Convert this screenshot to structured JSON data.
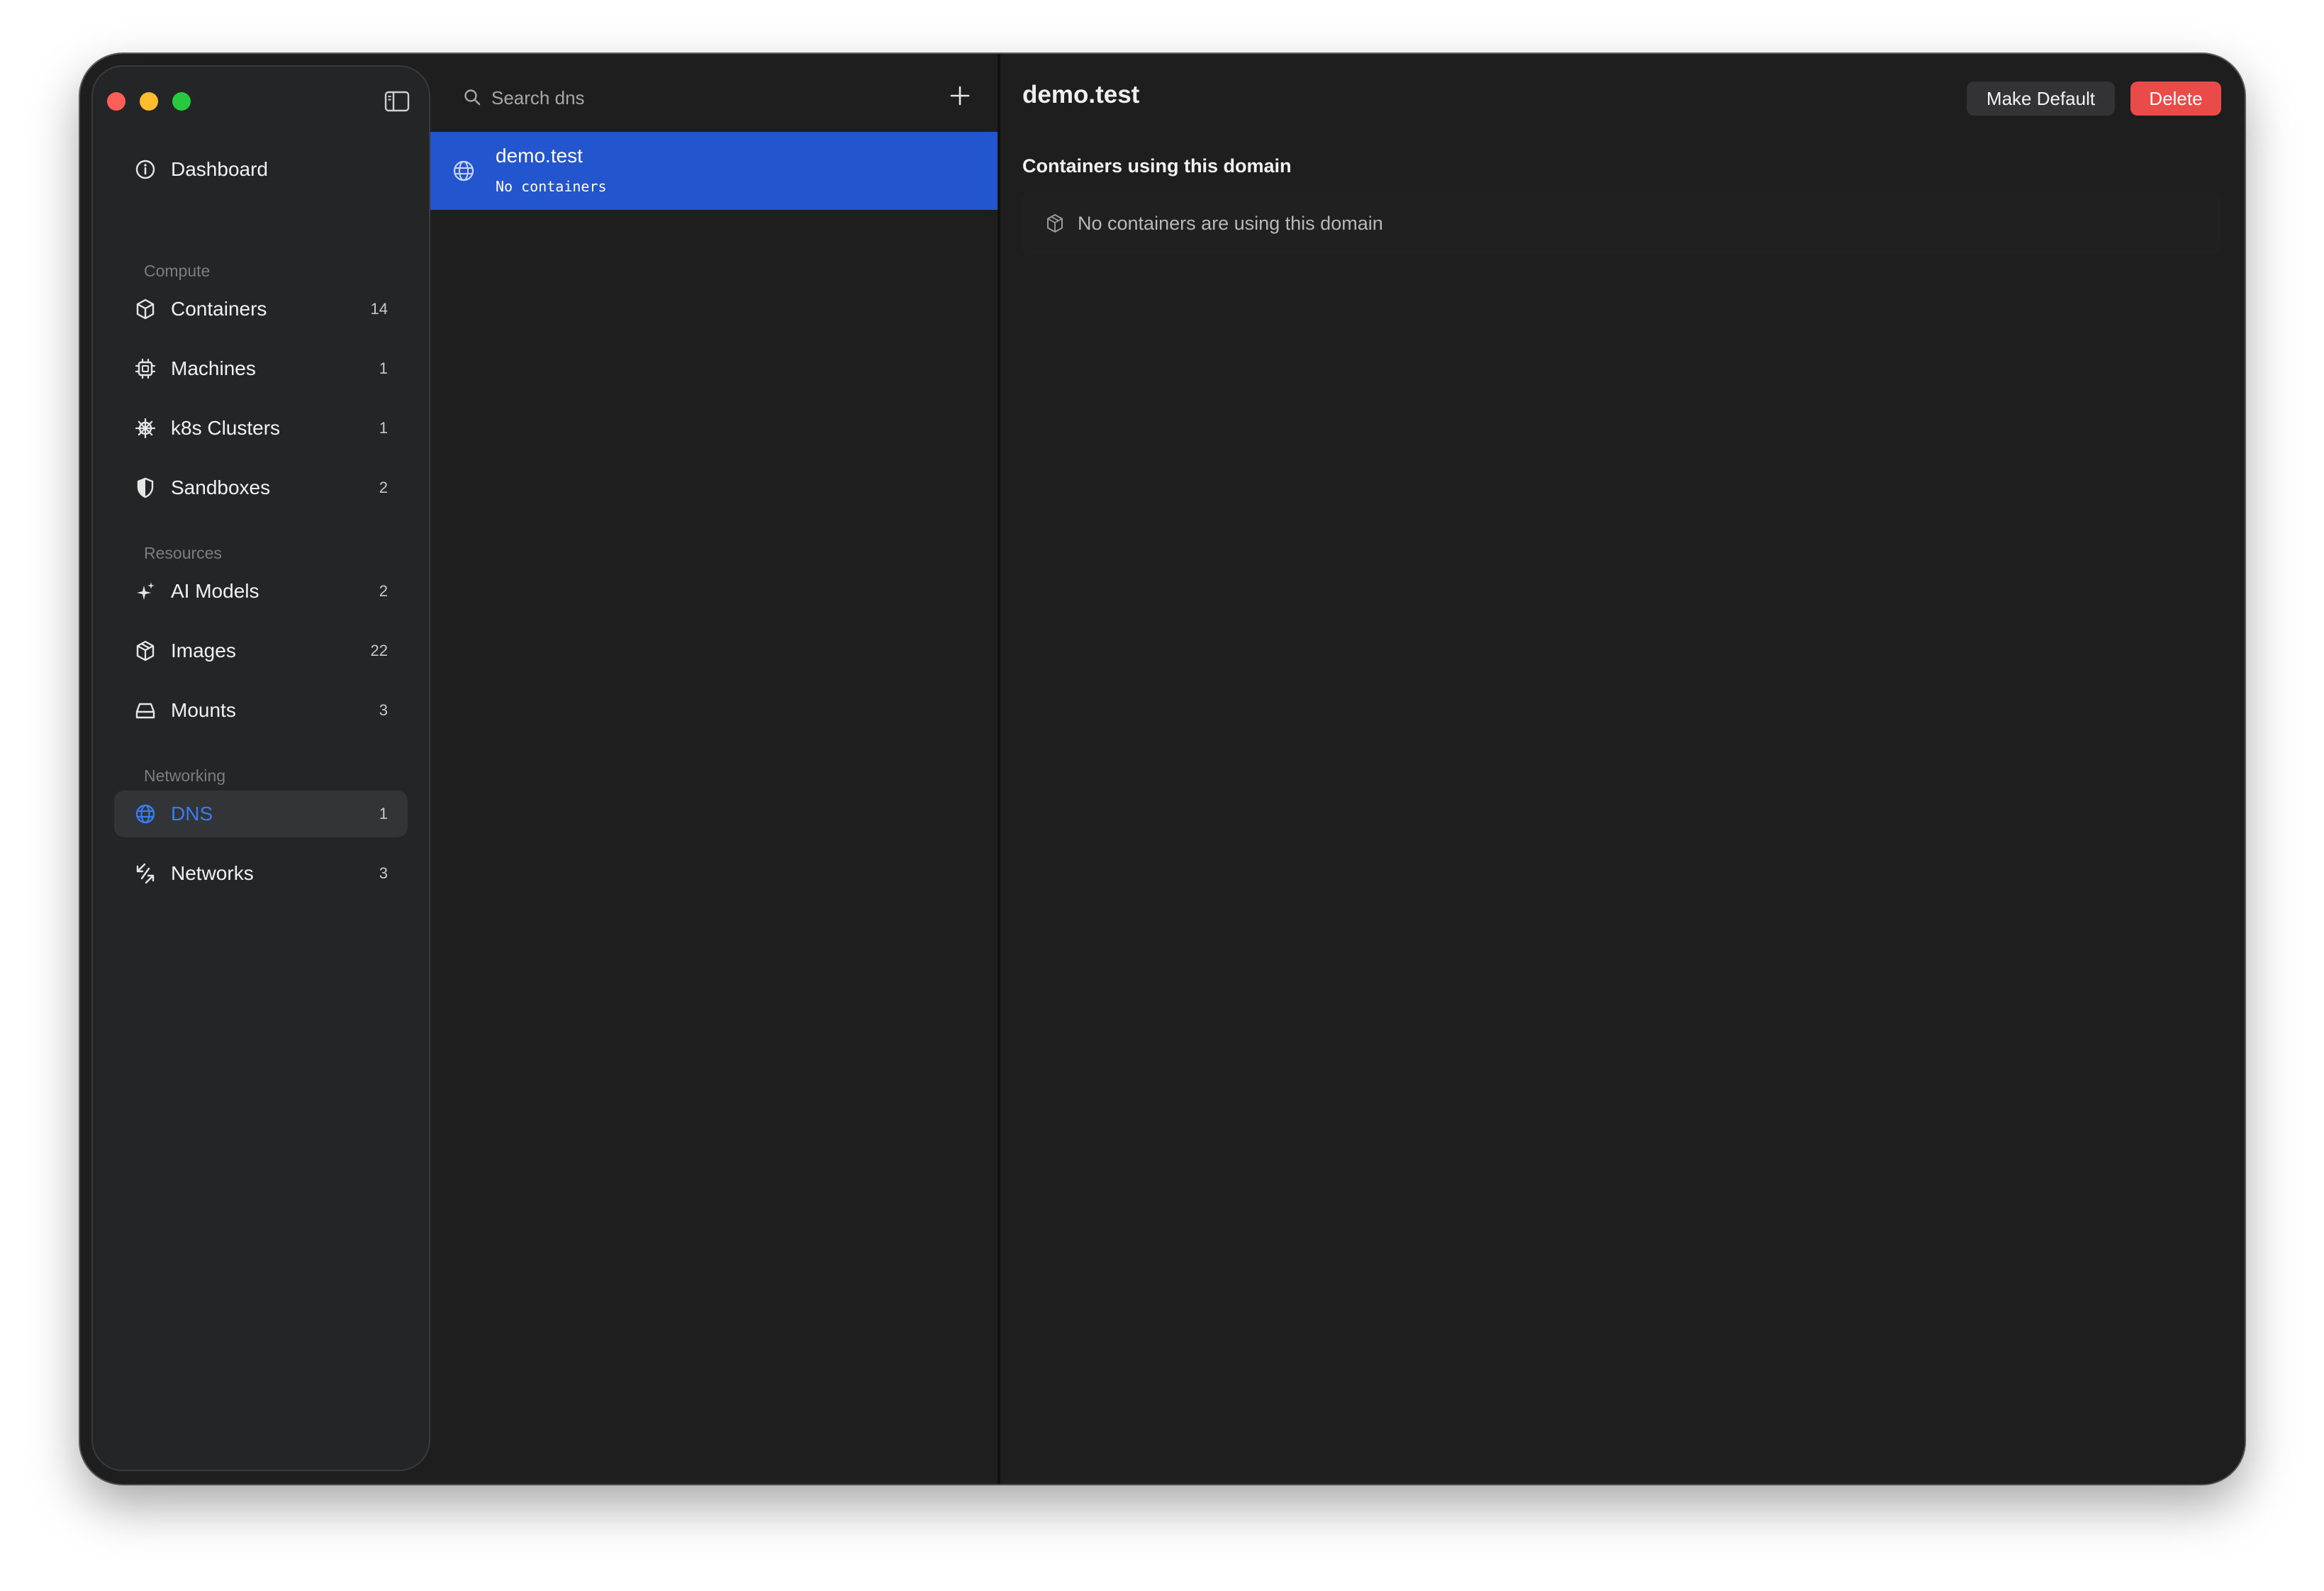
{
  "sidebar": {
    "toggle_icon": "sidebar-toggle-icon",
    "dashboard": {
      "label": "Dashboard",
      "icon": "info-icon"
    },
    "sections": {
      "compute": "Compute",
      "resources": "Resources",
      "networking": "Networking"
    },
    "items": {
      "containers": {
        "label": "Containers",
        "count": "14",
        "icon": "box-icon"
      },
      "machines": {
        "label": "Machines",
        "count": "1",
        "icon": "cpu-icon"
      },
      "k8s": {
        "label": "k8s Clusters",
        "count": "1",
        "icon": "helm-icon"
      },
      "sandboxes": {
        "label": "Sandboxes",
        "count": "2",
        "icon": "shield-icon"
      },
      "ai_models": {
        "label": "AI Models",
        "count": "2",
        "icon": "sparkles-icon"
      },
      "images": {
        "label": "Images",
        "count": "22",
        "icon": "package-icon"
      },
      "mounts": {
        "label": "Mounts",
        "count": "3",
        "icon": "drive-icon"
      },
      "dns": {
        "label": "DNS",
        "count": "1",
        "icon": "globe-icon",
        "active": true
      },
      "networks": {
        "label": "Networks",
        "count": "3",
        "icon": "arrows-icon"
      }
    }
  },
  "list": {
    "search_placeholder": "Search dns",
    "add_icon": "plus-icon",
    "selected": {
      "title": "demo.test",
      "subtitle": "No containers",
      "icon": "globe-icon"
    }
  },
  "detail": {
    "title": "demo.test",
    "make_default_label": "Make Default",
    "delete_label": "Delete",
    "section_heading": "Containers using this domain",
    "empty_text": "No containers are using this domain",
    "empty_icon": "package-icon"
  },
  "colors": {
    "accent": "#2355cf",
    "active_text": "#3b7bf0",
    "delete": "#e84b48",
    "window_bg": "#1e1e1e",
    "sidebar_bg": "#242527"
  }
}
